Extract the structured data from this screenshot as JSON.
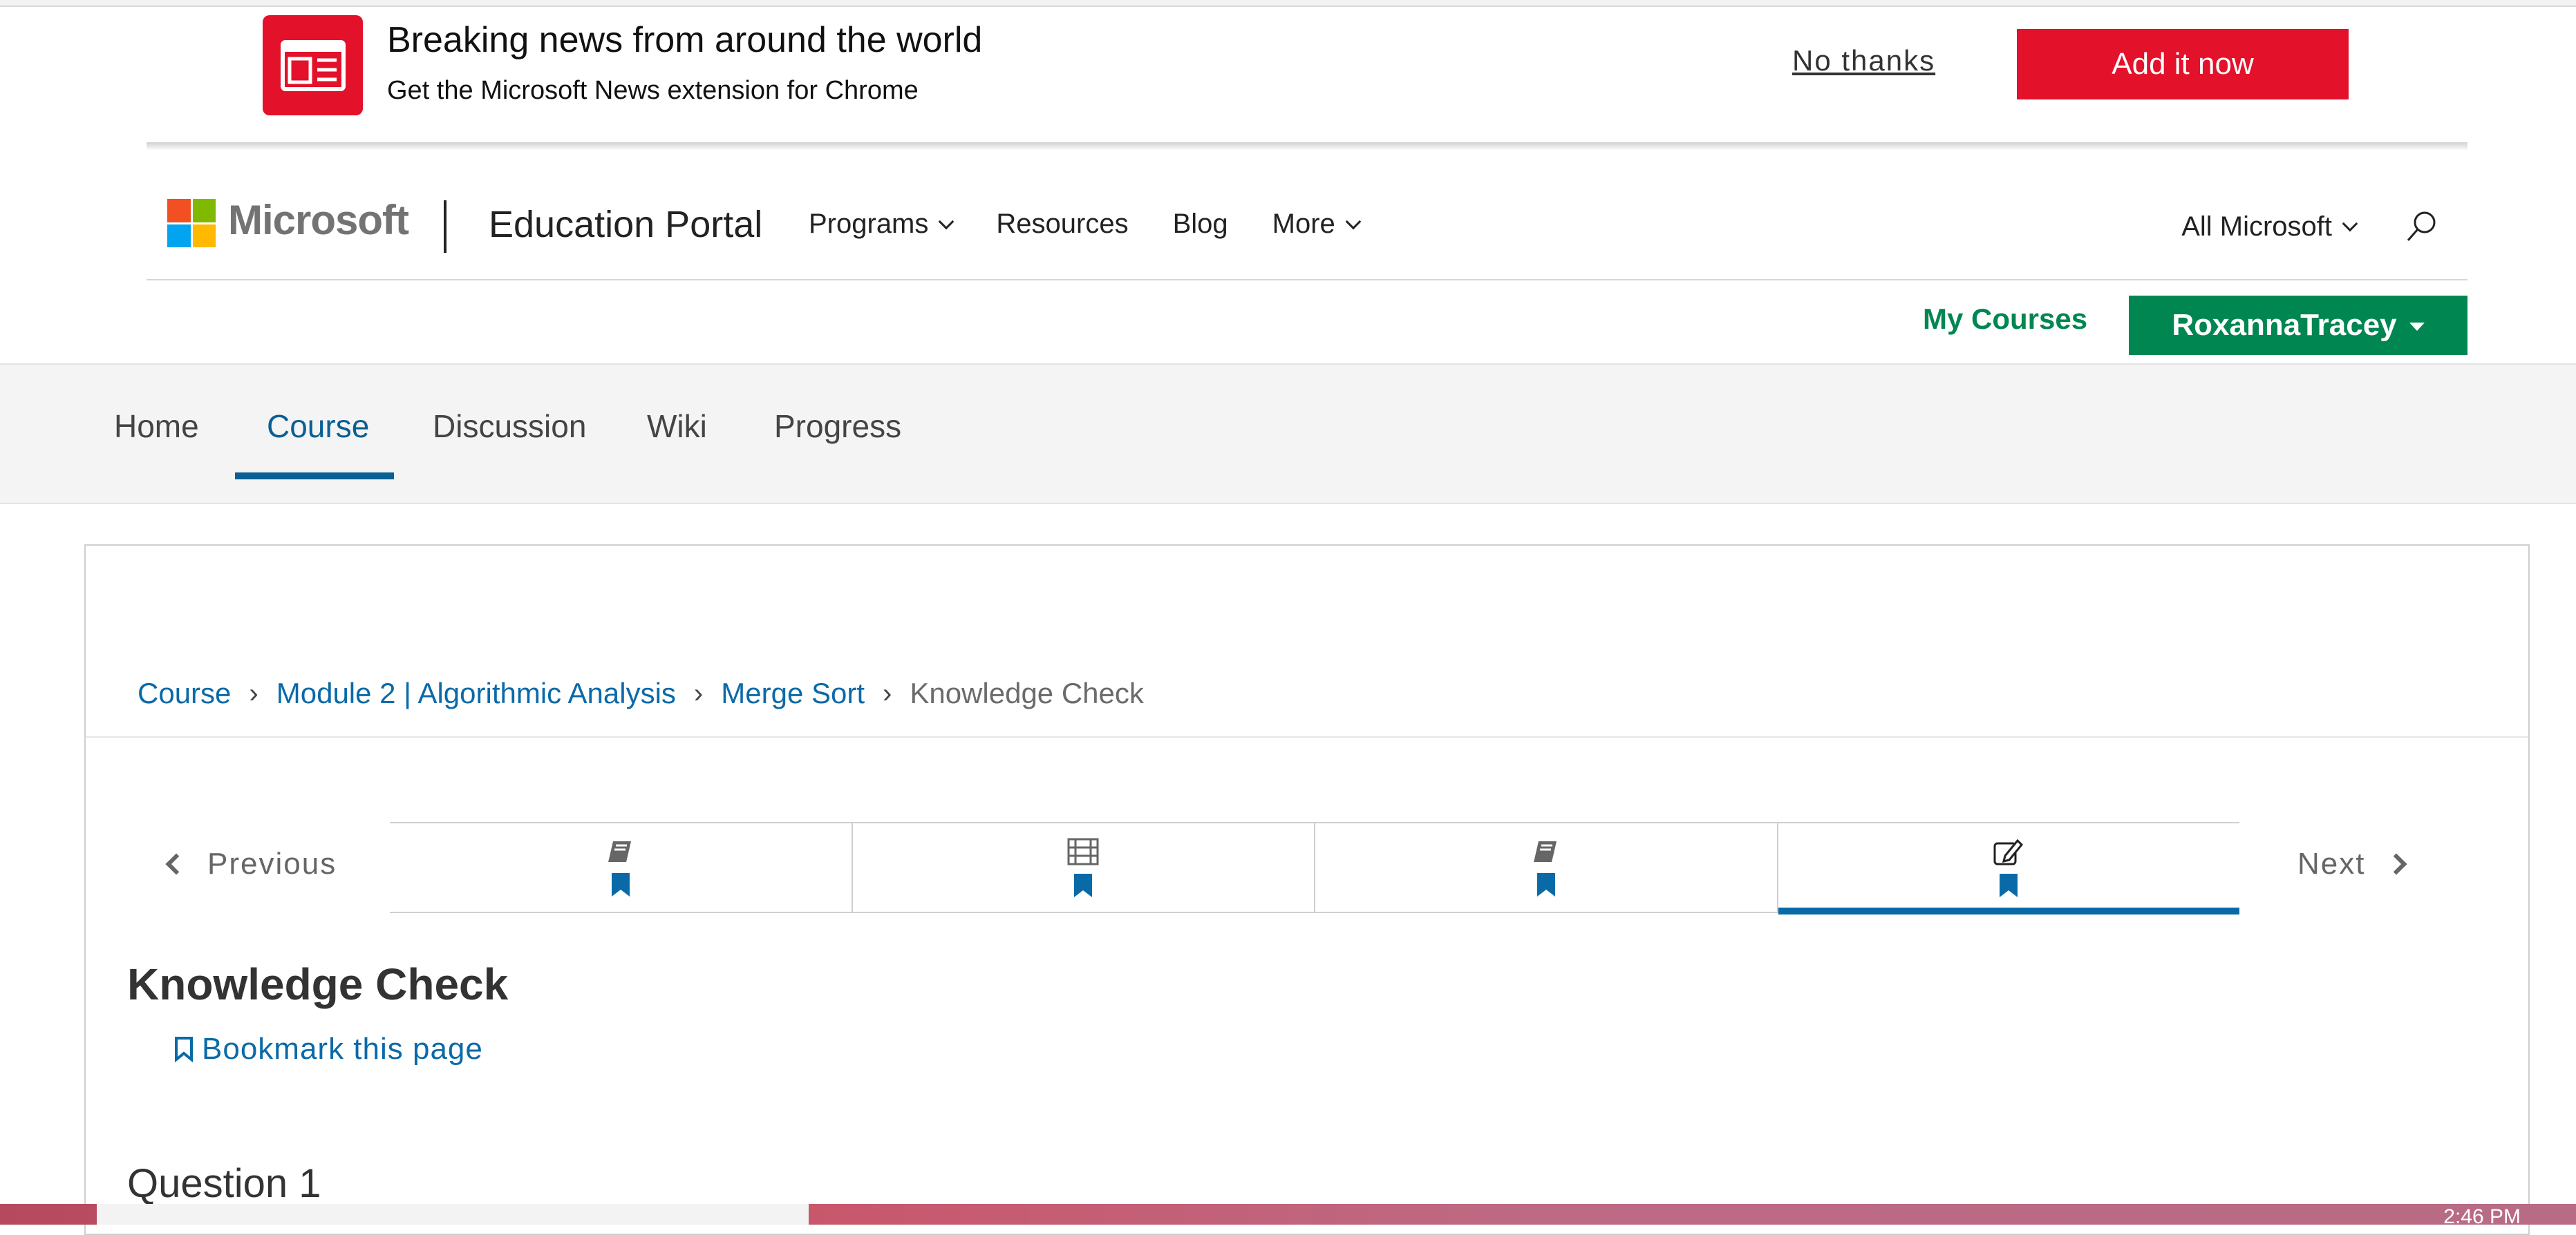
{
  "extension_banner": {
    "title": "Breaking news from around the world",
    "subtitle": "Get the Microsoft News extension for Chrome",
    "dismiss_label": "No thanks",
    "add_label": "Add it now",
    "logo_icon": "news-icon",
    "accent_color": "#e3112a"
  },
  "header": {
    "brand": "Microsoft",
    "portal": "Education Portal",
    "nav": [
      {
        "label": "Programs",
        "has_dropdown": true
      },
      {
        "label": "Resources",
        "has_dropdown": false
      },
      {
        "label": "Blog",
        "has_dropdown": false
      },
      {
        "label": "More",
        "has_dropdown": true
      }
    ],
    "all_microsoft": "All Microsoft",
    "search_icon": "search-icon"
  },
  "user": {
    "my_courses": "My Courses",
    "username": "RoxannaTracey",
    "accent_color": "#008651"
  },
  "course_tabs": {
    "items": [
      "Home",
      "Course",
      "Discussion",
      "Wiki",
      "Progress"
    ],
    "active": "Course",
    "active_color": "#0a5f93"
  },
  "breadcrumb": {
    "items": [
      "Course",
      "Module 2 | Algorithmic Analysis",
      "Merge Sort"
    ],
    "current": "Knowledge Check"
  },
  "sequence": {
    "previous": "Previous",
    "next": "Next",
    "units": [
      {
        "icon": "book-icon",
        "bookmarked": true,
        "active": false
      },
      {
        "icon": "video-icon",
        "bookmarked": true,
        "active": false
      },
      {
        "icon": "book-icon",
        "bookmarked": true,
        "active": false
      },
      {
        "icon": "edit-icon",
        "bookmarked": true,
        "active": true
      }
    ]
  },
  "unit": {
    "title": "Knowledge Check",
    "bookmark_label": "Bookmark this page",
    "question_title": "Question 1"
  },
  "taskbar": {
    "time": "2:46 PM"
  }
}
